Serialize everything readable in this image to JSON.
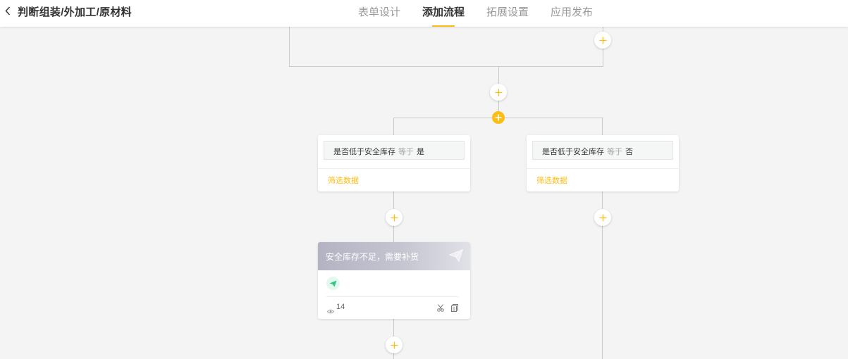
{
  "header": {
    "title": "判断组装/外加工/原材料",
    "tabs": [
      {
        "label": "表单设计",
        "active": false
      },
      {
        "label": "添加流程",
        "active": true
      },
      {
        "label": "拓展设置",
        "active": false
      },
      {
        "label": "应用发布",
        "active": false
      }
    ]
  },
  "branches": [
    {
      "condition": {
        "field": "是否低于安全库存",
        "operator": "等于",
        "value": "是"
      },
      "filter_label": "筛选数据"
    },
    {
      "condition": {
        "field": "是否低于安全库存",
        "operator": "等于",
        "value": "否"
      },
      "filter_label": "筛选数据"
    }
  ],
  "notify_node": {
    "title": "安全库存不足，需要补货",
    "view_count": "14"
  },
  "colors": {
    "accent": "#fcbd15",
    "line": "#cacaca",
    "notify_green": "#2fc783"
  }
}
